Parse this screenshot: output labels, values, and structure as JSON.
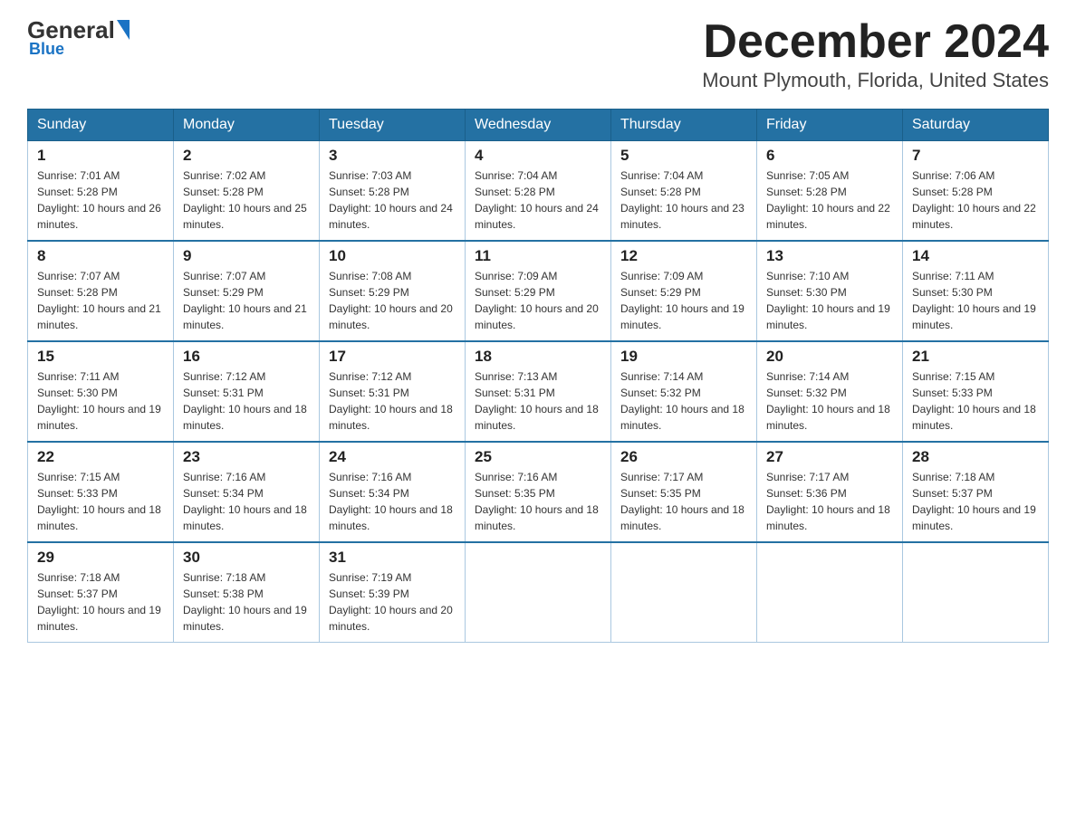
{
  "header": {
    "logo_general": "General",
    "logo_blue": "Blue",
    "month_title": "December 2024",
    "location": "Mount Plymouth, Florida, United States"
  },
  "days_of_week": [
    "Sunday",
    "Monday",
    "Tuesday",
    "Wednesday",
    "Thursday",
    "Friday",
    "Saturday"
  ],
  "weeks": [
    [
      {
        "day": "1",
        "sunrise": "7:01 AM",
        "sunset": "5:28 PM",
        "daylight": "10 hours and 26 minutes."
      },
      {
        "day": "2",
        "sunrise": "7:02 AM",
        "sunset": "5:28 PM",
        "daylight": "10 hours and 25 minutes."
      },
      {
        "day": "3",
        "sunrise": "7:03 AM",
        "sunset": "5:28 PM",
        "daylight": "10 hours and 24 minutes."
      },
      {
        "day": "4",
        "sunrise": "7:04 AM",
        "sunset": "5:28 PM",
        "daylight": "10 hours and 24 minutes."
      },
      {
        "day": "5",
        "sunrise": "7:04 AM",
        "sunset": "5:28 PM",
        "daylight": "10 hours and 23 minutes."
      },
      {
        "day": "6",
        "sunrise": "7:05 AM",
        "sunset": "5:28 PM",
        "daylight": "10 hours and 22 minutes."
      },
      {
        "day": "7",
        "sunrise": "7:06 AM",
        "sunset": "5:28 PM",
        "daylight": "10 hours and 22 minutes."
      }
    ],
    [
      {
        "day": "8",
        "sunrise": "7:07 AM",
        "sunset": "5:28 PM",
        "daylight": "10 hours and 21 minutes."
      },
      {
        "day": "9",
        "sunrise": "7:07 AM",
        "sunset": "5:29 PM",
        "daylight": "10 hours and 21 minutes."
      },
      {
        "day": "10",
        "sunrise": "7:08 AM",
        "sunset": "5:29 PM",
        "daylight": "10 hours and 20 minutes."
      },
      {
        "day": "11",
        "sunrise": "7:09 AM",
        "sunset": "5:29 PM",
        "daylight": "10 hours and 20 minutes."
      },
      {
        "day": "12",
        "sunrise": "7:09 AM",
        "sunset": "5:29 PM",
        "daylight": "10 hours and 19 minutes."
      },
      {
        "day": "13",
        "sunrise": "7:10 AM",
        "sunset": "5:30 PM",
        "daylight": "10 hours and 19 minutes."
      },
      {
        "day": "14",
        "sunrise": "7:11 AM",
        "sunset": "5:30 PM",
        "daylight": "10 hours and 19 minutes."
      }
    ],
    [
      {
        "day": "15",
        "sunrise": "7:11 AM",
        "sunset": "5:30 PM",
        "daylight": "10 hours and 19 minutes."
      },
      {
        "day": "16",
        "sunrise": "7:12 AM",
        "sunset": "5:31 PM",
        "daylight": "10 hours and 18 minutes."
      },
      {
        "day": "17",
        "sunrise": "7:12 AM",
        "sunset": "5:31 PM",
        "daylight": "10 hours and 18 minutes."
      },
      {
        "day": "18",
        "sunrise": "7:13 AM",
        "sunset": "5:31 PM",
        "daylight": "10 hours and 18 minutes."
      },
      {
        "day": "19",
        "sunrise": "7:14 AM",
        "sunset": "5:32 PM",
        "daylight": "10 hours and 18 minutes."
      },
      {
        "day": "20",
        "sunrise": "7:14 AM",
        "sunset": "5:32 PM",
        "daylight": "10 hours and 18 minutes."
      },
      {
        "day": "21",
        "sunrise": "7:15 AM",
        "sunset": "5:33 PM",
        "daylight": "10 hours and 18 minutes."
      }
    ],
    [
      {
        "day": "22",
        "sunrise": "7:15 AM",
        "sunset": "5:33 PM",
        "daylight": "10 hours and 18 minutes."
      },
      {
        "day": "23",
        "sunrise": "7:16 AM",
        "sunset": "5:34 PM",
        "daylight": "10 hours and 18 minutes."
      },
      {
        "day": "24",
        "sunrise": "7:16 AM",
        "sunset": "5:34 PM",
        "daylight": "10 hours and 18 minutes."
      },
      {
        "day": "25",
        "sunrise": "7:16 AM",
        "sunset": "5:35 PM",
        "daylight": "10 hours and 18 minutes."
      },
      {
        "day": "26",
        "sunrise": "7:17 AM",
        "sunset": "5:35 PM",
        "daylight": "10 hours and 18 minutes."
      },
      {
        "day": "27",
        "sunrise": "7:17 AM",
        "sunset": "5:36 PM",
        "daylight": "10 hours and 18 minutes."
      },
      {
        "day": "28",
        "sunrise": "7:18 AM",
        "sunset": "5:37 PM",
        "daylight": "10 hours and 19 minutes."
      }
    ],
    [
      {
        "day": "29",
        "sunrise": "7:18 AM",
        "sunset": "5:37 PM",
        "daylight": "10 hours and 19 minutes."
      },
      {
        "day": "30",
        "sunrise": "7:18 AM",
        "sunset": "5:38 PM",
        "daylight": "10 hours and 19 minutes."
      },
      {
        "day": "31",
        "sunrise": "7:19 AM",
        "sunset": "5:39 PM",
        "daylight": "10 hours and 20 minutes."
      },
      null,
      null,
      null,
      null
    ]
  ],
  "labels": {
    "sunrise_prefix": "Sunrise: ",
    "sunset_prefix": "Sunset: ",
    "daylight_prefix": "Daylight: "
  }
}
